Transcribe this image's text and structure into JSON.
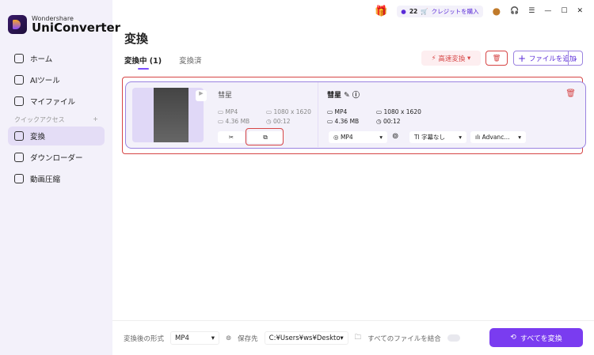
{
  "app": {
    "brand_small": "Wondershare",
    "brand_name": "UniConverter"
  },
  "sidebar": {
    "items": [
      {
        "label": "ホーム"
      },
      {
        "label": "AIツール"
      },
      {
        "label": "マイファイル"
      }
    ],
    "quick_access": "クイックアクセス",
    "quick_items": [
      {
        "label": "変換",
        "active": true
      },
      {
        "label": "ダウンローダー"
      },
      {
        "label": "動画圧縮"
      }
    ]
  },
  "topbar": {
    "credits": "22",
    "buy_credits": "クレジットを購入"
  },
  "main": {
    "title": "変換",
    "tabs": [
      {
        "label": "変換中 (1)"
      },
      {
        "label": "変換済"
      }
    ],
    "fast_convert": "高速変換",
    "add_file": "ファイルを追加"
  },
  "file": {
    "name": "彗星",
    "source": {
      "format": "MP4",
      "size": "4.36 MB",
      "resolution": "1080 x 1620",
      "duration": "00:12"
    },
    "target": {
      "name": "彗星",
      "format": "MP4",
      "size": "4.36 MB",
      "resolution": "1080 x 1620",
      "duration": "00:12"
    },
    "output_format": "MP4",
    "subtitle": "字幕なし",
    "audio": "Advanc..."
  },
  "bottom": {
    "format_label": "変換後の形式",
    "format_value": "MP4",
    "save_label": "保存先",
    "save_path": "C:¥Users¥ws¥Desktop¥\\",
    "merge_label": "すべてのファイルを結合",
    "merge_on": false,
    "convert_all": "すべてを変換"
  },
  "colors": {
    "accent": "#7a3cf0",
    "danger": "#d64545"
  }
}
